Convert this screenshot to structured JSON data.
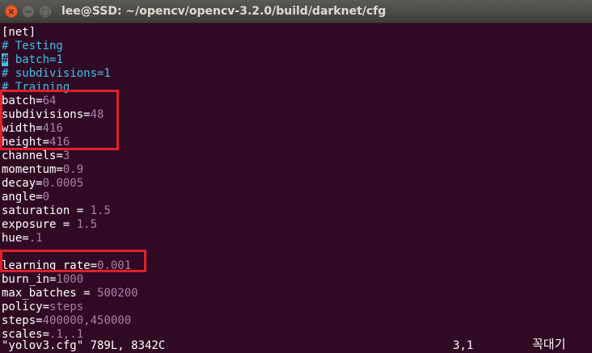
{
  "window": {
    "title": "lee@SSD: ~/opencv/opencv-3.2.0/build/darknet/cfg"
  },
  "editor": {
    "lines": [
      {
        "key": "[net]",
        "sep": "",
        "val": "",
        "type": "plain"
      },
      {
        "key": "# Testing",
        "sep": "",
        "val": "",
        "type": "comment"
      },
      {
        "key": "#",
        "sep": "",
        "val": " batch=1",
        "type": "comment-cursor"
      },
      {
        "key": "# subdivisions=1",
        "sep": "",
        "val": "",
        "type": "comment"
      },
      {
        "key": "# Training",
        "sep": "",
        "val": "",
        "type": "comment"
      },
      {
        "key": "batch",
        "sep": "=",
        "val": "64",
        "type": "kv"
      },
      {
        "key": "subdivisions",
        "sep": "=",
        "val": "48",
        "type": "kv"
      },
      {
        "key": "width",
        "sep": "=",
        "val": "416",
        "type": "kv"
      },
      {
        "key": "height",
        "sep": "=",
        "val": "416",
        "type": "kv"
      },
      {
        "key": "channels",
        "sep": "=",
        "val": "3",
        "type": "kv"
      },
      {
        "key": "momentum",
        "sep": "=",
        "val": "0.9",
        "type": "kv"
      },
      {
        "key": "decay",
        "sep": "=",
        "val": "0.0005",
        "type": "kv"
      },
      {
        "key": "angle",
        "sep": "=",
        "val": "0",
        "type": "kv"
      },
      {
        "key": "saturation",
        "sep": " = ",
        "val": "1.5",
        "type": "kv"
      },
      {
        "key": "exposure",
        "sep": " = ",
        "val": "1.5",
        "type": "kv"
      },
      {
        "key": "hue",
        "sep": "=",
        "val": ".1",
        "type": "kv"
      },
      {
        "key": "",
        "sep": "",
        "val": "",
        "type": "plain"
      },
      {
        "key": "learning_rate",
        "sep": "=",
        "val": "0.001",
        "type": "kv"
      },
      {
        "key": "burn_in",
        "sep": "=",
        "val": "1000",
        "type": "kv"
      },
      {
        "key": "max_batches",
        "sep": " = ",
        "val": "500200",
        "type": "kv"
      },
      {
        "key": "policy",
        "sep": "=",
        "val": "steps",
        "type": "kv"
      },
      {
        "key": "steps",
        "sep": "=",
        "val": "400000,450000",
        "type": "kv"
      },
      {
        "key": "scales",
        "sep": "=",
        "val": ".1,.1",
        "type": "kv"
      }
    ]
  },
  "statusbar": {
    "file_info": "\"yolov3.cfg\" 789L, 8342C",
    "position": "3,1",
    "mode": "꼭대기"
  },
  "colors": {
    "background": "#300a24",
    "text": "#ffffff",
    "comment": "#3fc0e7",
    "value": "#ad7fa8",
    "highlight_box": "#e0202a"
  }
}
